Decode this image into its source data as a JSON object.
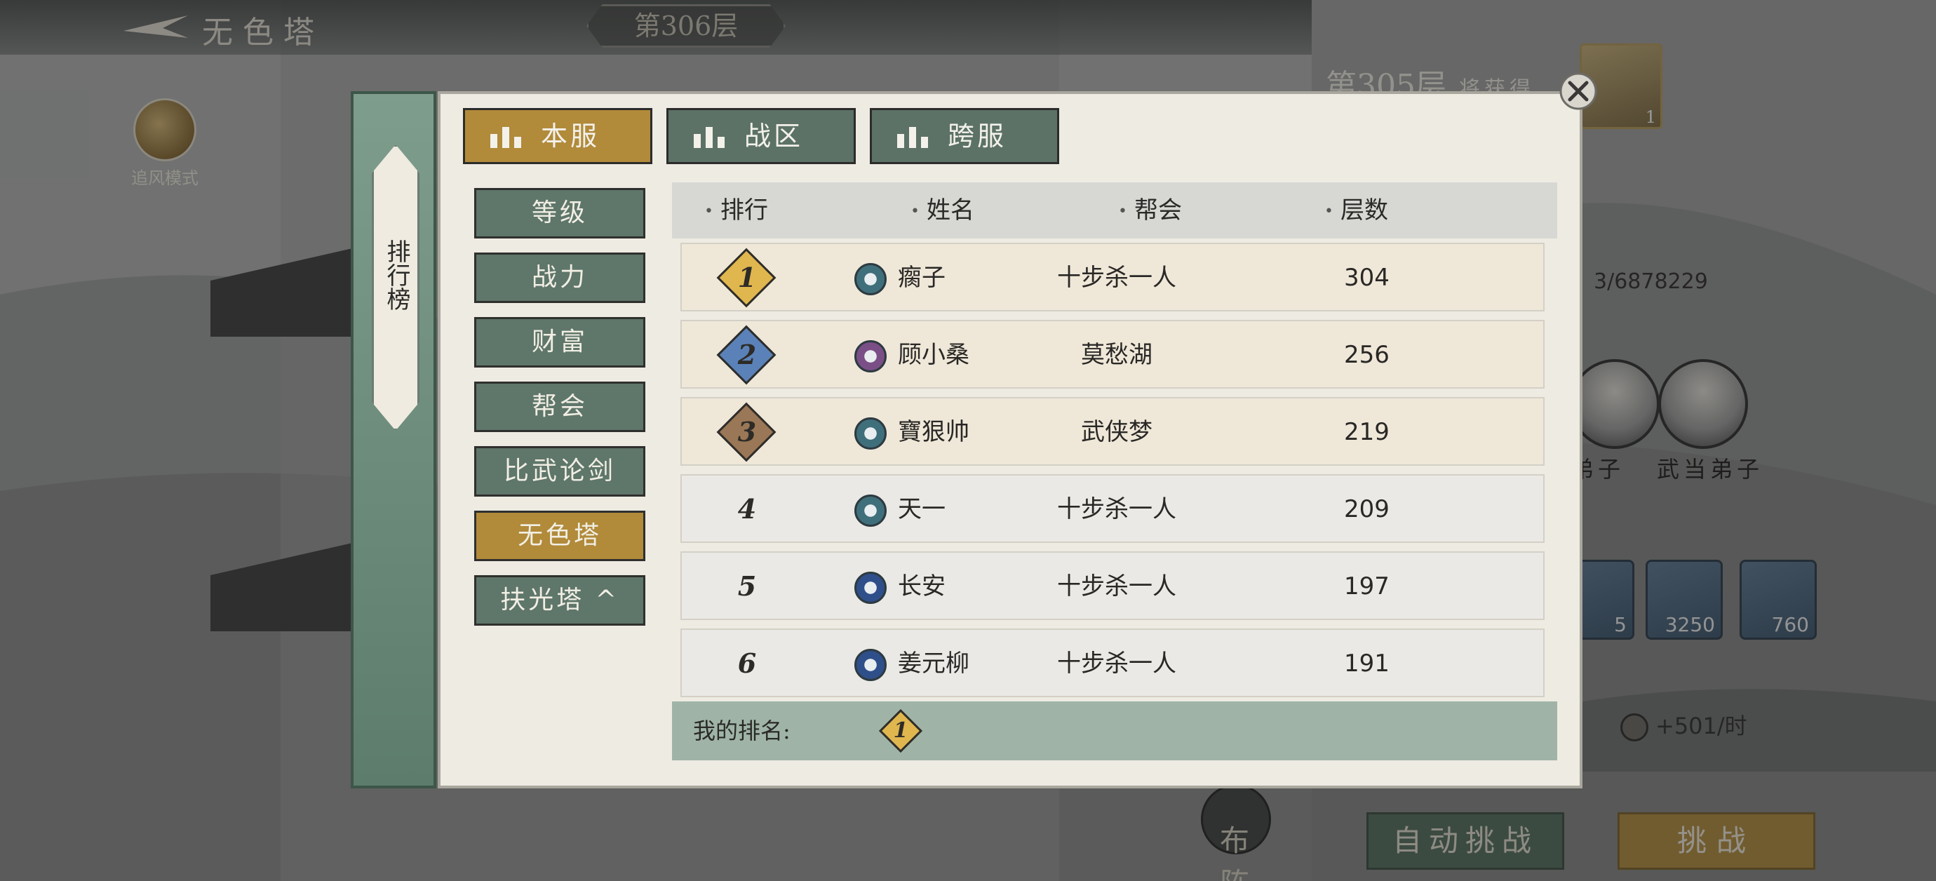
{
  "header": {
    "tower_title": "无色塔",
    "floor_badge": "第306层"
  },
  "left_side": {
    "zhuifeng_label": "追风模式"
  },
  "right_panel": {
    "floor": "第305层",
    "reward_label": "将获得",
    "reward_count": "1",
    "exp_text": "3/6878229",
    "portraits": [
      {
        "label": "弟子"
      },
      {
        "label": "武当弟子"
      }
    ],
    "resources": [
      {
        "count": "5"
      },
      {
        "count": "3250"
      },
      {
        "count": "760"
      }
    ],
    "income": "+501/时",
    "formation_label": "布阵",
    "auto_challenge_label": "自动挑战",
    "challenge_label": "挑战"
  },
  "leaderboard": {
    "side_tab_label": "排行榜",
    "server_tabs": [
      {
        "label": "本服",
        "active": true
      },
      {
        "label": "战区",
        "active": false
      },
      {
        "label": "跨服",
        "active": false
      }
    ],
    "categories": [
      {
        "label": "等级",
        "active": false
      },
      {
        "label": "战力",
        "active": false
      },
      {
        "label": "财富",
        "active": false
      },
      {
        "label": "帮会",
        "active": false
      },
      {
        "label": "比武论剑",
        "active": false
      },
      {
        "label": "无色塔",
        "active": true
      },
      {
        "label": "扶光塔 ^",
        "active": false
      }
    ],
    "columns": {
      "rank": "排行",
      "name": "姓名",
      "guild": "帮会",
      "floors": "层数"
    },
    "rows": [
      {
        "rank": "1",
        "name": "瘸子",
        "guild": "十步杀一人",
        "floors": "304",
        "rank_color": "#e0b64e",
        "icon_color": "#3f6f7a"
      },
      {
        "rank": "2",
        "name": "顾小桑",
        "guild": "莫愁湖",
        "floors": "256",
        "rank_color": "#5b82b8",
        "icon_color": "#7a4f86"
      },
      {
        "rank": "3",
        "name": "寶狠帅",
        "guild": "武侠梦",
        "floors": "219",
        "rank_color": "#9a7756",
        "icon_color": "#3f6f7a"
      },
      {
        "rank": "4",
        "name": "天一",
        "guild": "十步杀一人",
        "floors": "209",
        "icon_color": "#3f6f7a"
      },
      {
        "rank": "5",
        "name": "长安",
        "guild": "十步杀一人",
        "floors": "197",
        "icon_color": "#2f4f8a"
      },
      {
        "rank": "6",
        "name": "姜元柳",
        "guild": "十步杀一人",
        "floors": "191",
        "icon_color": "#2f4f8a"
      }
    ],
    "my_rank": {
      "label": "我的排名:",
      "rank": "1"
    },
    "colors": {
      "active": "#b18a3a",
      "inactive": "#5f766a"
    }
  }
}
